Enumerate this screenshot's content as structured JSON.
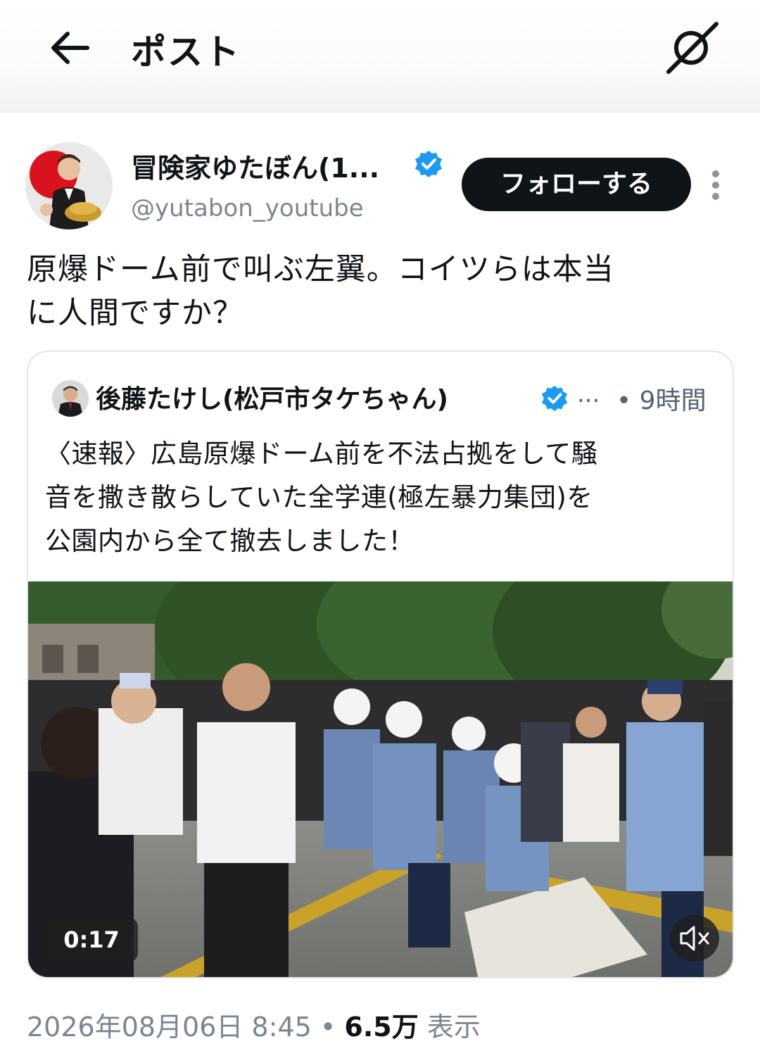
{
  "header": {
    "title": "ポスト"
  },
  "author": {
    "display_name": "冒険家ゆたぼん(1...",
    "handle": "@yutabon_youtube",
    "follow_label": "フォローする"
  },
  "post": {
    "text_line1": "原爆ドーム前で叫ぶ左翼。コイツらは本当",
    "text_line2": "に人間ですか？",
    "timestamp": "2026年08月06日 8:45",
    "separator": " • ",
    "views_count": "6.5万",
    "views_label": " 表示"
  },
  "quoted": {
    "display_name": "後藤たけし(松戸市タケちゃん)",
    "ellipsis": "...",
    "time": "• 9時間",
    "text_line1": "〈速報〉広島原爆ドーム前を不法占拠をして騒",
    "text_line2": "音を撒き散らしていた全学連(極左暴力集団)を",
    "text_line3": "公園内から全て撤去しました！",
    "video_duration": "0:17"
  },
  "colors": {
    "verified": "#1d9bf0",
    "follow_button": "#0f1419",
    "muted_text": "#7a8691"
  },
  "icons": [
    "back-arrow-icon",
    "grok-icon",
    "verified-badge-icon",
    "more-options-icon",
    "mute-icon"
  ]
}
